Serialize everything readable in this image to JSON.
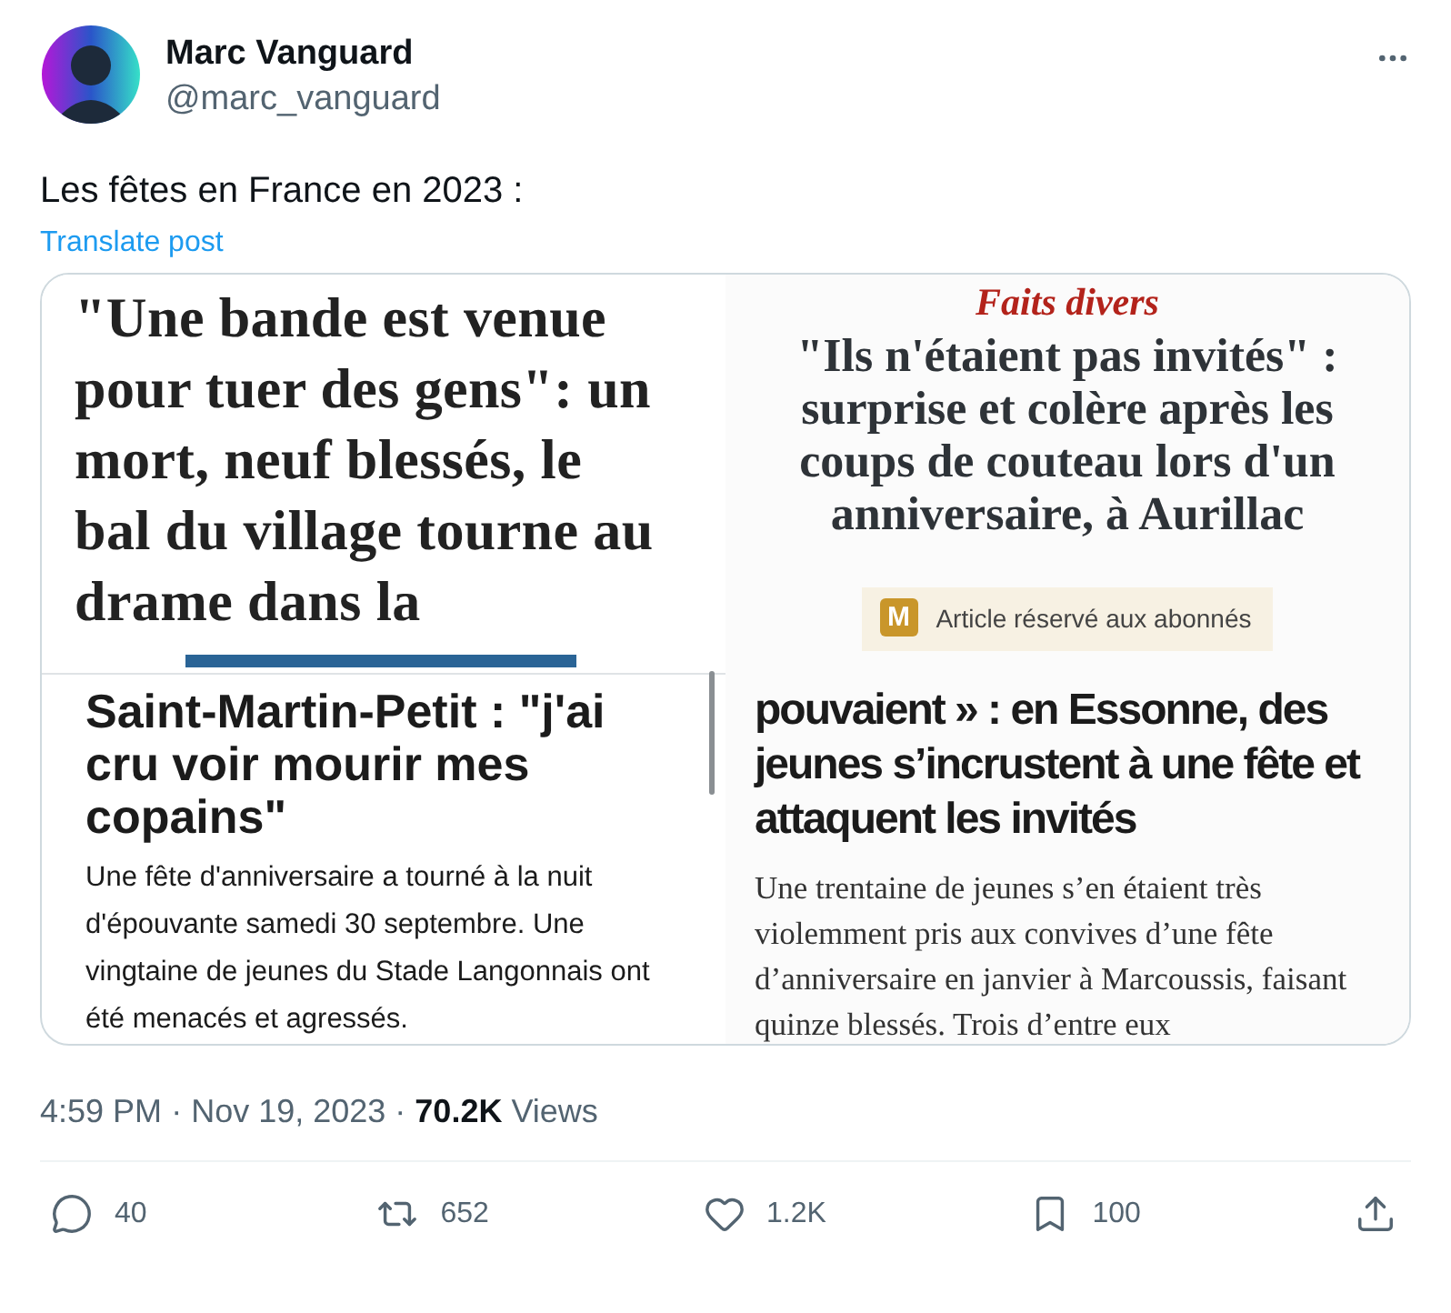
{
  "author": {
    "name": "Marc Vanguard",
    "handle": "@marc_vanguard"
  },
  "post": {
    "text": "Les fêtes en France en 2023 :",
    "translate_link": "Translate post"
  },
  "media": {
    "articles": [
      {
        "kind": "serif-lead",
        "headline": "\"Une bande est venue pour tuer des gens\": un mort, neuf blessés, le bal du village tourne au drame dans la"
      },
      {
        "kind": "serif-centered",
        "kicker": "Faits divers",
        "headline": "\"Ils n'étaient pas invités\" : surprise et colère après les coups de couteau lors d'un anniversaire, à Aurillac",
        "badge": {
          "letter": "M",
          "label": "Article réservé aux abonnés"
        }
      },
      {
        "kind": "sans",
        "headline": "Saint-Martin-Petit : \"j'ai cru voir mourir mes copains\"",
        "body": "Une fête d'anniversaire a tourné à la nuit d'épouvante samedi 30 septembre. Une vingtaine de jeunes du Stade Langonnais ont été menacés et agressés."
      },
      {
        "kind": "condensed",
        "headline": "pouvaient » : en Essonne, des jeunes s’incrustent à une fête et attaquent les invités",
        "body": "Une trentaine de jeunes s’en étaient très violemment pris aux convives d’une fête d’anniversaire en janvier à Marcoussis, faisant quinze blessés. Trois d’entre eux"
      }
    ]
  },
  "meta": {
    "separator": "·",
    "time": "4:59 PM",
    "date": "Nov 19, 2023",
    "views_count": "70.2K",
    "views_label": "Views"
  },
  "actions": [
    {
      "kind": "reply",
      "count": "40"
    },
    {
      "kind": "repost",
      "count": "652"
    },
    {
      "kind": "like",
      "count": "1.2K"
    },
    {
      "kind": "bookmark",
      "count": "100"
    },
    {
      "kind": "share"
    }
  ]
}
